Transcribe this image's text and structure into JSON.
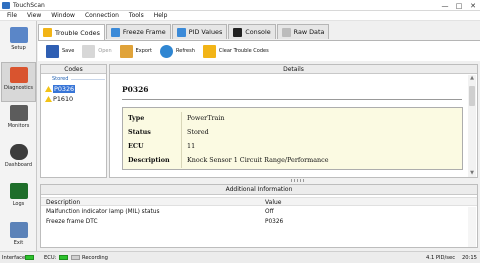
{
  "app": {
    "title": "TouchScan"
  },
  "window_controls": {
    "minimize": "—",
    "maximize": "□",
    "close": "✕"
  },
  "menu": [
    "File",
    "View",
    "Window",
    "Connection",
    "Tools",
    "Help"
  ],
  "sidebar": {
    "items": [
      {
        "label": "Setup",
        "icon": "setup-icon",
        "color": "#5a86c8"
      },
      {
        "label": "Diagnostics",
        "icon": "diagnostics-icon",
        "color": "#d9542f"
      },
      {
        "label": "Monitors",
        "icon": "monitors-icon",
        "color": "#5c5c5c"
      },
      {
        "label": "Dashboard",
        "icon": "dashboard-icon",
        "color": "#3c3c3c"
      },
      {
        "label": "Logs",
        "icon": "logs-icon",
        "color": "#1e6e2a"
      },
      {
        "label": "Exit",
        "icon": "exit-icon",
        "color": "#5b82b8"
      }
    ]
  },
  "tabs": [
    {
      "label": "Trouble Codes",
      "icon": "trouble-codes-icon",
      "color": "#f2b416",
      "active": true
    },
    {
      "label": "Freeze Frame",
      "icon": "freeze-frame-icon",
      "color": "#3b8ad8"
    },
    {
      "label": "PID Values",
      "icon": "pid-values-icon",
      "color": "#3b8ad8"
    },
    {
      "label": "Console",
      "icon": "console-icon",
      "color": "#222222"
    },
    {
      "label": "Raw Data",
      "icon": "raw-data-icon",
      "color": "#bcbcbc"
    }
  ],
  "toolbar": {
    "save": "Save",
    "open": "Open",
    "export": "Export",
    "refresh": "Refresh",
    "clear": "Clear Trouble Codes"
  },
  "codes_panel": {
    "header": "Codes",
    "group_label": "Stored",
    "items": [
      "P0326",
      "P1610"
    ],
    "selected": "P0326"
  },
  "details_panel": {
    "header": "Details",
    "code": "P0326",
    "rows": [
      {
        "key": "Type",
        "value": "PowerTrain"
      },
      {
        "key": "Status",
        "value": "Stored"
      },
      {
        "key": "ECU",
        "value": "11"
      },
      {
        "key": "Description",
        "value": "Knock Sensor 1 Circuit Range/Performance"
      }
    ]
  },
  "additional_info": {
    "header": "Additional Information",
    "columns": {
      "description": "Description",
      "value": "Value"
    },
    "rows": [
      {
        "description": "Malfunction indicator lamp (MIL) status",
        "value": "Off"
      },
      {
        "description": "Freeze frame DTC",
        "value": "P0326"
      }
    ]
  },
  "status": {
    "interface_label": "Interface:",
    "ecu_label": "ECU:",
    "recording_label": "Recording",
    "rate": "4.1 PID/sec",
    "time": "20:15"
  }
}
